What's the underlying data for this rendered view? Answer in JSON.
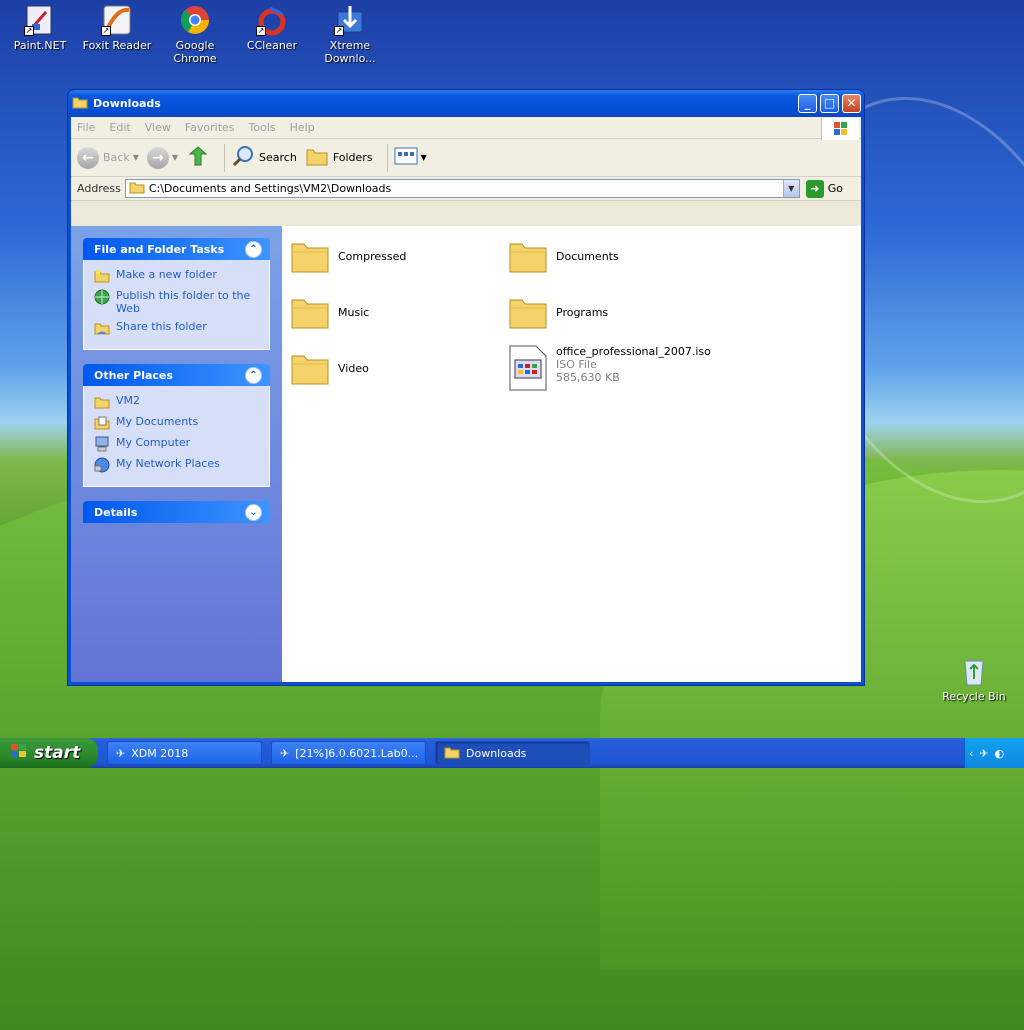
{
  "desktop": {
    "icons": [
      {
        "label": "Paint.NET",
        "icon": "paintnet-icon"
      },
      {
        "label": "Foxit Reader",
        "icon": "foxit-icon"
      },
      {
        "label": "Google Chrome",
        "icon": "chrome-icon"
      },
      {
        "label": "CCleaner",
        "icon": "ccleaner-icon"
      },
      {
        "label": "Xtreme Downlo...",
        "icon": "xdm-icon"
      },
      {
        "label": "Recycle Bin",
        "icon": "recycle-bin-icon"
      }
    ]
  },
  "window": {
    "title": "Downloads",
    "menu": [
      "File",
      "Edit",
      "View",
      "Favorites",
      "Tools",
      "Help"
    ],
    "toolbar": {
      "back": "Back",
      "search": "Search",
      "folders": "Folders"
    },
    "address": {
      "label": "Address",
      "value": "C:\\Documents and Settings\\VM2\\Downloads",
      "go": "Go"
    },
    "tasks_panel": {
      "title": "File and Folder Tasks",
      "items": [
        "Make a new folder",
        "Publish this folder to the Web",
        "Share this folder"
      ]
    },
    "places_panel": {
      "title": "Other Places",
      "items": [
        "VM2",
        "My Documents",
        "My Computer",
        "My Network Places"
      ]
    },
    "details_panel": {
      "title": "Details"
    },
    "files": [
      {
        "name": "Compressed",
        "type": "folder"
      },
      {
        "name": "Documents",
        "type": "folder"
      },
      {
        "name": "Music",
        "type": "folder"
      },
      {
        "name": "Programs",
        "type": "folder"
      },
      {
        "name": "Video",
        "type": "folder"
      },
      {
        "name": "office_professional_2007.iso",
        "type": "file",
        "desc": "ISO File",
        "size": "585,630 KB"
      }
    ]
  },
  "taskbar": {
    "start": "start",
    "tasks": [
      "XDM 2018",
      "[21%]6.0.6021.Lab0...",
      "Downloads"
    ]
  },
  "colors": {
    "accent": "#0a50d0",
    "link": "#215dc6",
    "folder": "#f5d36b"
  }
}
